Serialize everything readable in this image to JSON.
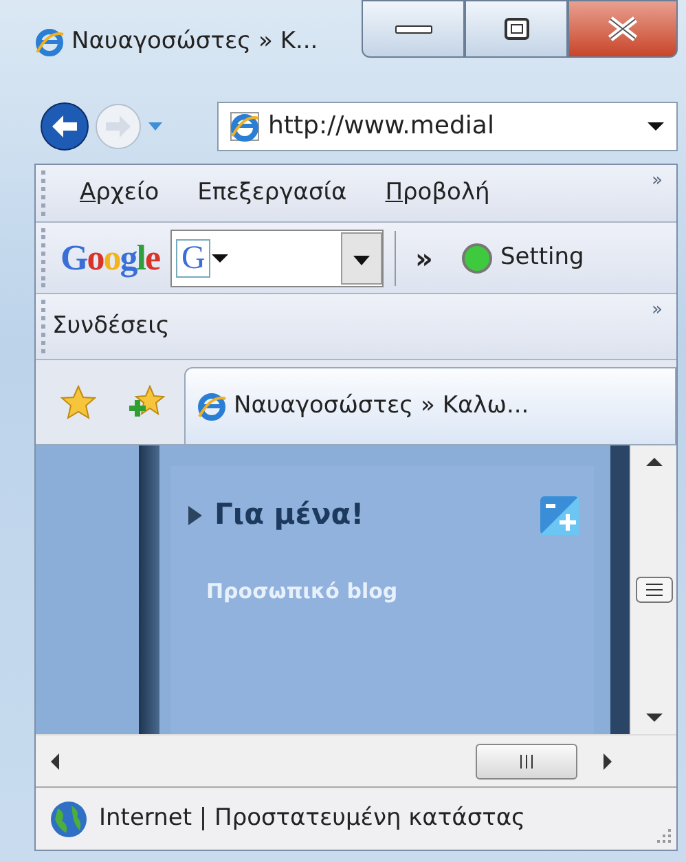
{
  "window": {
    "title": "Ναυαγοσώστες » Κ..."
  },
  "navigation": {
    "address": "http://www.medial"
  },
  "menu_bar": {
    "items": [
      {
        "label": "Αρχείο",
        "mnemonic_first": true
      },
      {
        "label": "Επεξεργασία",
        "mnemonic_first": false
      },
      {
        "label": "Προβολή",
        "mnemonic_first": true
      }
    ],
    "overflow": "»"
  },
  "google_toolbar": {
    "logo": "Google",
    "engine_letter": "G",
    "overflow": "»",
    "settings_label": "Setting"
  },
  "links_bar": {
    "label": "Συνδέσεις",
    "overflow": "»"
  },
  "tabs": [
    {
      "label": "Ναυαγοσώστες » Καλω...",
      "selected": true
    }
  ],
  "page": {
    "widget_title": "Για μένα!",
    "widget_subtitle": "Προσωπικό blog"
  },
  "status_bar": {
    "text": "Internet | Προστατευμένη κατάστας"
  }
}
